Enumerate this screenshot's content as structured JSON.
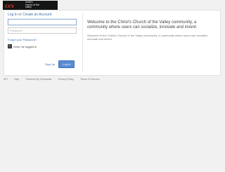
{
  "header": {
    "logo_mark": "ccv",
    "logo_text": "christ's church of the valley"
  },
  "login": {
    "login_link": "Log In",
    "or_text": "or",
    "create_link": "Create an Account",
    "username_placeholder": "",
    "password_placeholder": "Password",
    "forgot_link": "Forgot your Password?",
    "keep_logged_in": "Keep me logged in",
    "keep_checked": true,
    "signup_link": "Sign Up",
    "login_button": "Log In"
  },
  "welcome": {
    "title": "Welcome to the Christ's Church of the Valley community, a community where users can socialize, innovate and invent.",
    "body": "Welcome to the Christ's Church of the Valley community, a community where users can socialize, innovate and invent."
  },
  "footer": {
    "links": [
      "API",
      "Help",
      "Powered By Socialcast",
      "Privacy Policy",
      "Terms Of Service"
    ]
  },
  "colors": {
    "accent": "#5a8bd3",
    "logo_bg": "#151515",
    "logo_mark": "#c0362c"
  }
}
